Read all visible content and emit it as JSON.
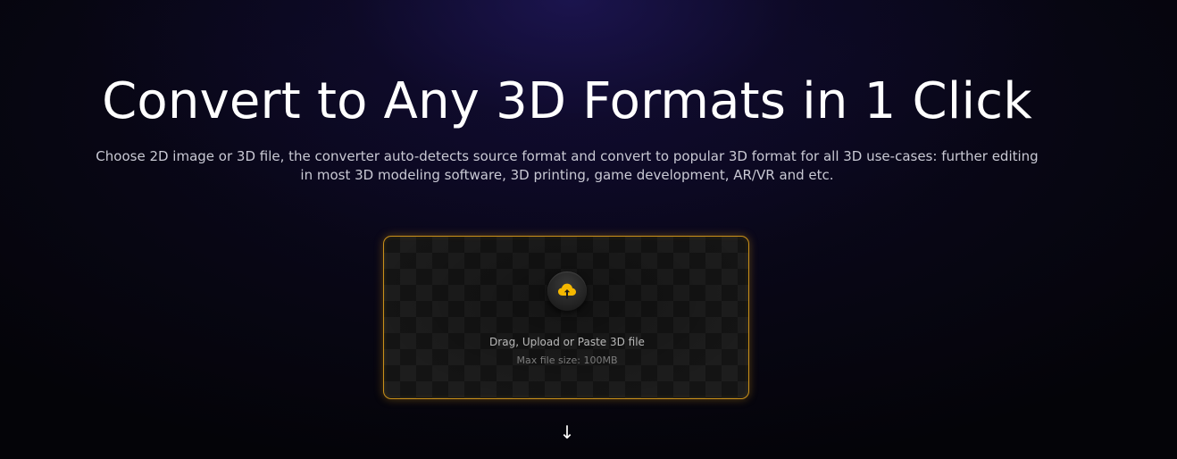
{
  "hero": {
    "title": "Convert to Any 3D Formats in 1 Click",
    "subtitle": "Choose 2D image or 3D file, the converter auto-detects source format and convert to popular 3D format for all 3D use-cases: further editing in most 3D modeling software, 3D printing, game development, AR/VR and etc."
  },
  "upload": {
    "icon": "cloud-upload-icon",
    "label": "Drag, Upload or Paste 3D file",
    "hint": "Max file size: 100MB",
    "accent_color": "#f5b800",
    "border_color": "#c9901a"
  },
  "scroll": {
    "icon": "down-arrow-icon",
    "glyph": "↓"
  }
}
